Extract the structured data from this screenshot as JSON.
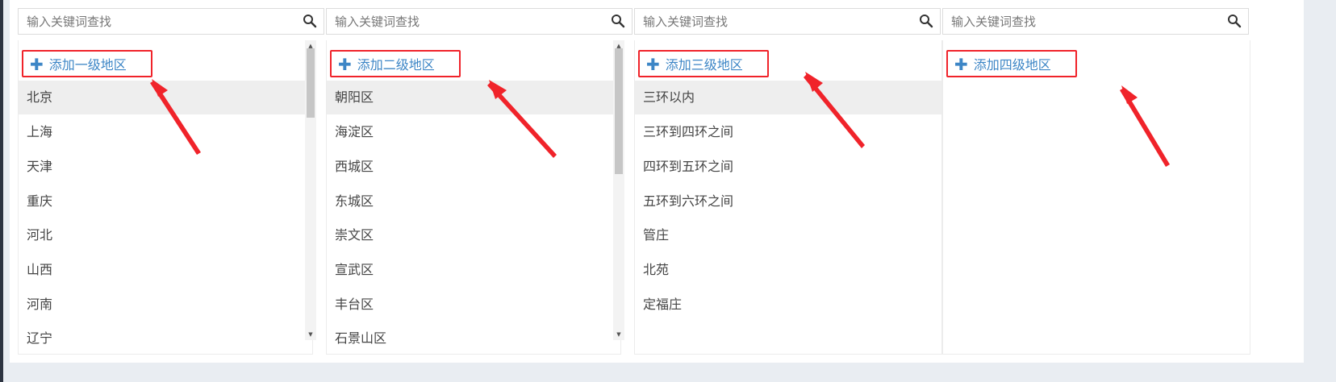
{
  "search": {
    "placeholder": "输入关键词查找"
  },
  "columns": [
    {
      "add_label": "添加一级地区",
      "items": [
        "北京",
        "上海",
        "天津",
        "重庆",
        "河北",
        "山西",
        "河南",
        "辽宁"
      ],
      "selected_index": 0
    },
    {
      "add_label": "添加二级地区",
      "items": [
        "朝阳区",
        "海淀区",
        "西城区",
        "东城区",
        "崇文区",
        "宣武区",
        "丰台区",
        "石景山区"
      ],
      "selected_index": 0
    },
    {
      "add_label": "添加三级地区",
      "items": [
        "三环以内",
        "三环到四环之间",
        "四环到五环之间",
        "五环到六环之间",
        "管庄",
        "北苑",
        "定福庄"
      ],
      "selected_index": 0
    },
    {
      "add_label": "添加四级地区",
      "items": []
    }
  ],
  "colors": {
    "highlight_box": "#f0232a",
    "link_blue": "#3d86c6",
    "selected_row": "#eeeeee"
  },
  "icons": {
    "search": "search-icon",
    "add": "plus-icon",
    "annotation": "red-arrow"
  }
}
